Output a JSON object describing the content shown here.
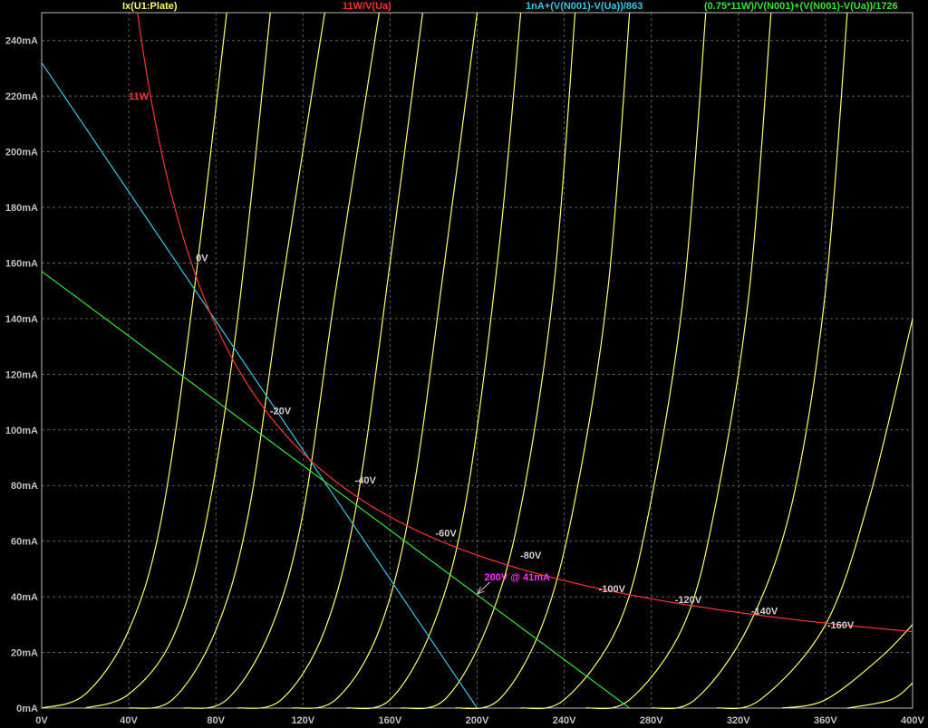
{
  "legend": [
    {
      "text": "Ix(U1:Plate)",
      "color": "#ffff66"
    },
    {
      "text": "11W/V(Ua)",
      "color": "#ff3333"
    },
    {
      "text": "1nA+(V(N001)-V(Ua))/863",
      "color": "#33c8e6"
    },
    {
      "text": "(0.75*11W)/V(N001)+(V(N001)-V(Ua))/1726",
      "color": "#33e633"
    }
  ],
  "chart_data": {
    "type": "line",
    "xlim": [
      0,
      400
    ],
    "ylim": [
      0,
      250
    ],
    "x_unit": "V",
    "y_unit": "mA",
    "x_ticks": [
      "0V",
      "40V",
      "80V",
      "120V",
      "160V",
      "200V",
      "240V",
      "280V",
      "320V",
      "360V",
      "400V"
    ],
    "y_ticks": [
      "0mA",
      "20mA",
      "40mA",
      "60mA",
      "80mA",
      "100mA",
      "120mA",
      "140mA",
      "160mA",
      "180mA",
      "200mA",
      "220mA",
      "240mA"
    ],
    "grid": true,
    "plate_curves": [
      {
        "label": "0V",
        "label_at": [
          70,
          162
        ],
        "points": [
          [
            0,
            0
          ],
          [
            20,
            5
          ],
          [
            40,
            28
          ],
          [
            55,
            68
          ],
          [
            70,
            150
          ],
          [
            85,
            250
          ]
        ]
      },
      {
        "label": "",
        "label_at": null,
        "points": [
          [
            20,
            0
          ],
          [
            40,
            5
          ],
          [
            60,
            25
          ],
          [
            75,
            65
          ],
          [
            90,
            140
          ],
          [
            105,
            250
          ]
        ]
      },
      {
        "label": "-20V",
        "label_at": [
          104,
          107
        ],
        "points": [
          [
            40,
            0
          ],
          [
            60,
            3
          ],
          [
            80,
            28
          ],
          [
            95,
            70
          ],
          [
            110,
            150
          ],
          [
            130,
            250
          ]
        ]
      },
      {
        "label": "",
        "label_at": null,
        "points": [
          [
            65,
            0
          ],
          [
            85,
            3
          ],
          [
            105,
            28
          ],
          [
            120,
            70
          ],
          [
            135,
            150
          ],
          [
            155,
            250
          ]
        ]
      },
      {
        "label": "-40V",
        "label_at": [
          143,
          82
        ],
        "points": [
          [
            90,
            0
          ],
          [
            110,
            3
          ],
          [
            130,
            28
          ],
          [
            145,
            75
          ],
          [
            160,
            160
          ],
          [
            175,
            250
          ]
        ]
      },
      {
        "label": "",
        "label_at": null,
        "points": [
          [
            115,
            0
          ],
          [
            135,
            3
          ],
          [
            155,
            28
          ],
          [
            170,
            75
          ],
          [
            185,
            160
          ],
          [
            200,
            250
          ]
        ]
      },
      {
        "label": "-60V",
        "label_at": [
          180,
          63
        ],
        "points": [
          [
            140,
            0
          ],
          [
            160,
            3
          ],
          [
            180,
            30
          ],
          [
            195,
            75
          ],
          [
            210,
            165
          ],
          [
            220,
            250
          ]
        ]
      },
      {
        "label": "-80V",
        "label_at": [
          219,
          55
        ],
        "points": [
          [
            165,
            0
          ],
          [
            185,
            3
          ],
          [
            205,
            30
          ],
          [
            220,
            72
          ],
          [
            235,
            150
          ],
          [
            245,
            250
          ]
        ]
      },
      {
        "label": "-100V",
        "label_at": [
          255,
          43
        ],
        "points": [
          [
            190,
            0
          ],
          [
            210,
            3
          ],
          [
            230,
            30
          ],
          [
            245,
            75
          ],
          [
            260,
            150
          ],
          [
            270,
            250
          ]
        ]
      },
      {
        "label": "-120V",
        "label_at": [
          290,
          39
        ],
        "points": [
          [
            220,
            0
          ],
          [
            240,
            3
          ],
          [
            265,
            30
          ],
          [
            280,
            75
          ],
          [
            295,
            150
          ],
          [
            305,
            250
          ]
        ]
      },
      {
        "label": "-140V",
        "label_at": [
          325,
          35
        ],
        "points": [
          [
            250,
            0
          ],
          [
            270,
            3
          ],
          [
            295,
            30
          ],
          [
            310,
            75
          ],
          [
            325,
            150
          ],
          [
            335,
            250
          ]
        ]
      },
      {
        "label": "-160V",
        "label_at": [
          360,
          30
        ],
        "points": [
          [
            280,
            0
          ],
          [
            300,
            3
          ],
          [
            325,
            30
          ],
          [
            345,
            75
          ],
          [
            360,
            150
          ],
          [
            370,
            250
          ]
        ]
      },
      {
        "label": "",
        "label_at": null,
        "points": [
          [
            310,
            0
          ],
          [
            330,
            3
          ],
          [
            360,
            30
          ],
          [
            380,
            75
          ],
          [
            400,
            140
          ]
        ]
      },
      {
        "label": "",
        "label_at": null,
        "points": [
          [
            340,
            0
          ],
          [
            360,
            3
          ],
          [
            385,
            18
          ],
          [
            400,
            30
          ]
        ]
      },
      {
        "label": "",
        "label_at": null,
        "points": [
          [
            370,
            0
          ],
          [
            390,
            3
          ],
          [
            400,
            9
          ]
        ]
      }
    ],
    "dissipation_curve": {
      "name": "11W/V(Ua)",
      "label": "11W",
      "label_at": [
        40,
        220
      ],
      "power_w": 11,
      "x_from": 44,
      "x_to": 400
    },
    "load_lines": [
      {
        "name": "1nA+(V(N001)-V(Ua))/863",
        "v_supply": 200,
        "r_load": 863,
        "i_at_zero": 232,
        "x_zero_current": 200
      },
      {
        "name": "(0.75*11W)/V(N001)+(V(N001)-V(Ua))/1726",
        "points": [
          [
            0,
            157
          ],
          [
            270,
            0
          ]
        ]
      }
    ],
    "annotation": {
      "text": "200V @ 41mA",
      "x": 200,
      "y": 41,
      "color": "#ff33ff"
    }
  }
}
